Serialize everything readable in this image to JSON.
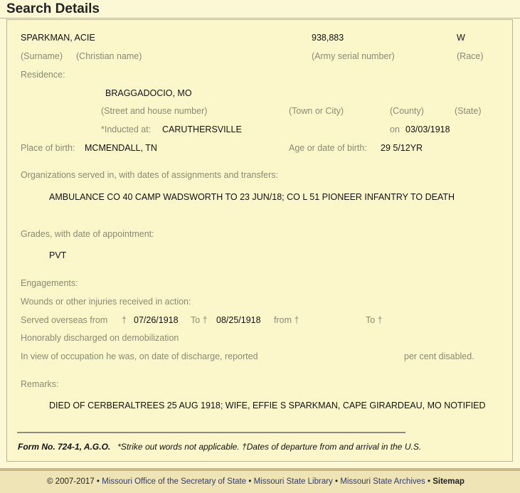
{
  "title": "Search Details",
  "record": {
    "name": "SPARKMAN, ACIE",
    "serial": "938,883",
    "race": "W",
    "surname_label": "(Surname)",
    "christian_label": "(Christian name)",
    "serial_label": "(Army serial number)",
    "race_label": "(Race)",
    "residence_label": "Residence:",
    "residence_value": "BRAGGADOCIO, MO",
    "street_label": "(Street and house number)",
    "town_label": "(Town or City)",
    "county_label": "(County)",
    "state_label": "(State)",
    "inducted_label": "*Inducted at:",
    "inducted_value": "CARUTHERSVILLE",
    "on_label": "on",
    "on_value": "03/03/1918",
    "birth_place_label": "Place of birth:",
    "birth_place_value": "MCMENDALL, TN",
    "age_label": "Age or date of birth:",
    "age_value": "29 5/12YR",
    "orgs_label": "Organizations served in, with dates of assignments and transfers:",
    "orgs_value": "AMBULANCE CO 40 CAMP WADSWORTH TO 23 JUN/18; CO L 51 PIONEER INFANTRY TO DEATH",
    "grades_label": "Grades, with date of appointment:",
    "grades_value": "PVT",
    "engagements_label": "Engagements:",
    "wounds_label": "Wounds or other injuries received in action:",
    "overseas_label": "Served overseas from",
    "dagger": "†",
    "overseas_from": "07/26/1918",
    "to_label": "To †",
    "overseas_to": "08/25/1918",
    "from2_label": "from †",
    "to2_label": "To †",
    "discharged_label": "Honorably discharged on demobilization",
    "occupation_label": "In view of occupation he was, on date of discharge, reported",
    "disabled_label": "per cent disabled.",
    "remarks_label": "Remarks:",
    "remarks_value": "DIED OF CERBERALTREES 25 AUG 1918; WIFE, EFFIE S SPARKMAN, CAPE GIRARDEAU, MO NOTIFIED"
  },
  "form_note": {
    "form_no": "Form No. 724-1, A.G.O.",
    "note": "*Strike out words not applicable. †Dates of departure from and arrival in the U.S."
  },
  "footer": {
    "copyright": "© 2007-2017",
    "bullet": "•",
    "link1": "Missouri Office of the Secretary of State",
    "link2": "Missouri State Library",
    "link3": "Missouri State Archives",
    "sitemap": "Sitemap"
  }
}
